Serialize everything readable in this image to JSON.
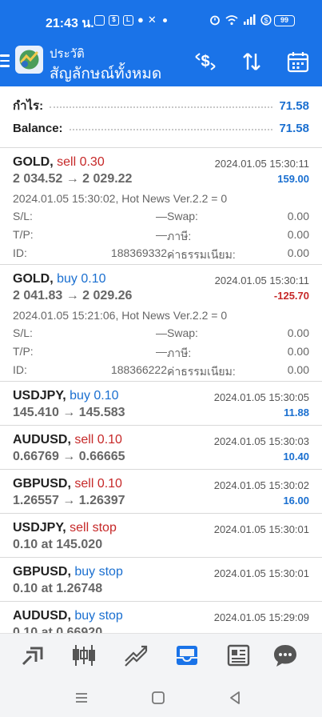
{
  "status_bar": {
    "time": "21:43 น.",
    "battery": "99"
  },
  "header": {
    "title_small": "ประวัติ",
    "title_big": "สัญลักษณ์ทั้งหมด"
  },
  "summary": {
    "profit_label": "กำไร:",
    "profit_value": "71.58",
    "balance_label": "Balance:",
    "balance_value": "71.58"
  },
  "labels": {
    "sl": "S/L:",
    "tp": "T/P:",
    "id": "ID:",
    "swap": "Swap:",
    "tax": "ภาษี:",
    "commission": "ค่าธรรมเนียม:"
  },
  "deals": [
    {
      "symbol": "GOLD,",
      "action": "sell 0.30",
      "side": "sell",
      "prices": "2 034.52 → 2 029.22",
      "time": "2024.01.05 15:30:11",
      "profit": "159.00",
      "profit_sign": "pos",
      "comment": "2024.01.05 15:30:02, Hot News Ver.2.2 = 0",
      "sl": "—",
      "tp": "—",
      "id": "188369332",
      "swap": "0.00",
      "tax": "0.00",
      "commission": "0.00"
    },
    {
      "symbol": "GOLD,",
      "action": "buy 0.10",
      "side": "buy",
      "prices": "2 041.83 → 2 029.26",
      "time": "2024.01.05 15:30:11",
      "profit": "-125.70",
      "profit_sign": "neg",
      "comment": "2024.01.05 15:21:06, Hot News Ver.2.2 = 0",
      "sl": "—",
      "tp": "—",
      "id": "188366222",
      "swap": "0.00",
      "tax": "0.00",
      "commission": "0.00"
    },
    {
      "symbol": "USDJPY,",
      "action": "buy 0.10",
      "side": "buy",
      "prices": "145.410 → 145.583",
      "time": "2024.01.05 15:30:05",
      "profit": "11.88",
      "profit_sign": "pos"
    },
    {
      "symbol": "AUDUSD,",
      "action": "sell 0.10",
      "side": "sell",
      "prices": "0.66769 → 0.66665",
      "time": "2024.01.05 15:30:03",
      "profit": "10.40",
      "profit_sign": "pos"
    },
    {
      "symbol": "GBPUSD,",
      "action": "sell 0.10",
      "side": "sell",
      "prices": "1.26557 → 1.26397",
      "time": "2024.01.05 15:30:02",
      "profit": "16.00",
      "profit_sign": "pos"
    },
    {
      "symbol": "USDJPY,",
      "action": "sell stop",
      "side": "sell",
      "prices": "0.10 at 145.020",
      "time": "2024.01.05 15:30:01",
      "profit": "",
      "profit_sign": "pos"
    },
    {
      "symbol": "GBPUSD,",
      "action": "buy stop",
      "side": "buy",
      "prices": "0.10 at 1.26748",
      "time": "2024.01.05 15:30:01",
      "profit": "",
      "profit_sign": "pos"
    },
    {
      "symbol": "AUDUSD,",
      "action": "buy stop",
      "side": "buy",
      "prices": "0.10 at 0.66920",
      "time": "2024.01.05 15:29:09",
      "profit": "",
      "profit_sign": "pos"
    }
  ],
  "bottom_nav": [
    {
      "icon": "quotes-icon"
    },
    {
      "icon": "chart-icon"
    },
    {
      "icon": "trade-icon"
    },
    {
      "icon": "history-icon",
      "active": true
    },
    {
      "icon": "news-icon"
    },
    {
      "icon": "chat-icon"
    }
  ],
  "colors": {
    "primary": "#1a73e8",
    "sell": "#c62828",
    "buy": "#1a6fd0",
    "inactive_icon": "#555555"
  }
}
